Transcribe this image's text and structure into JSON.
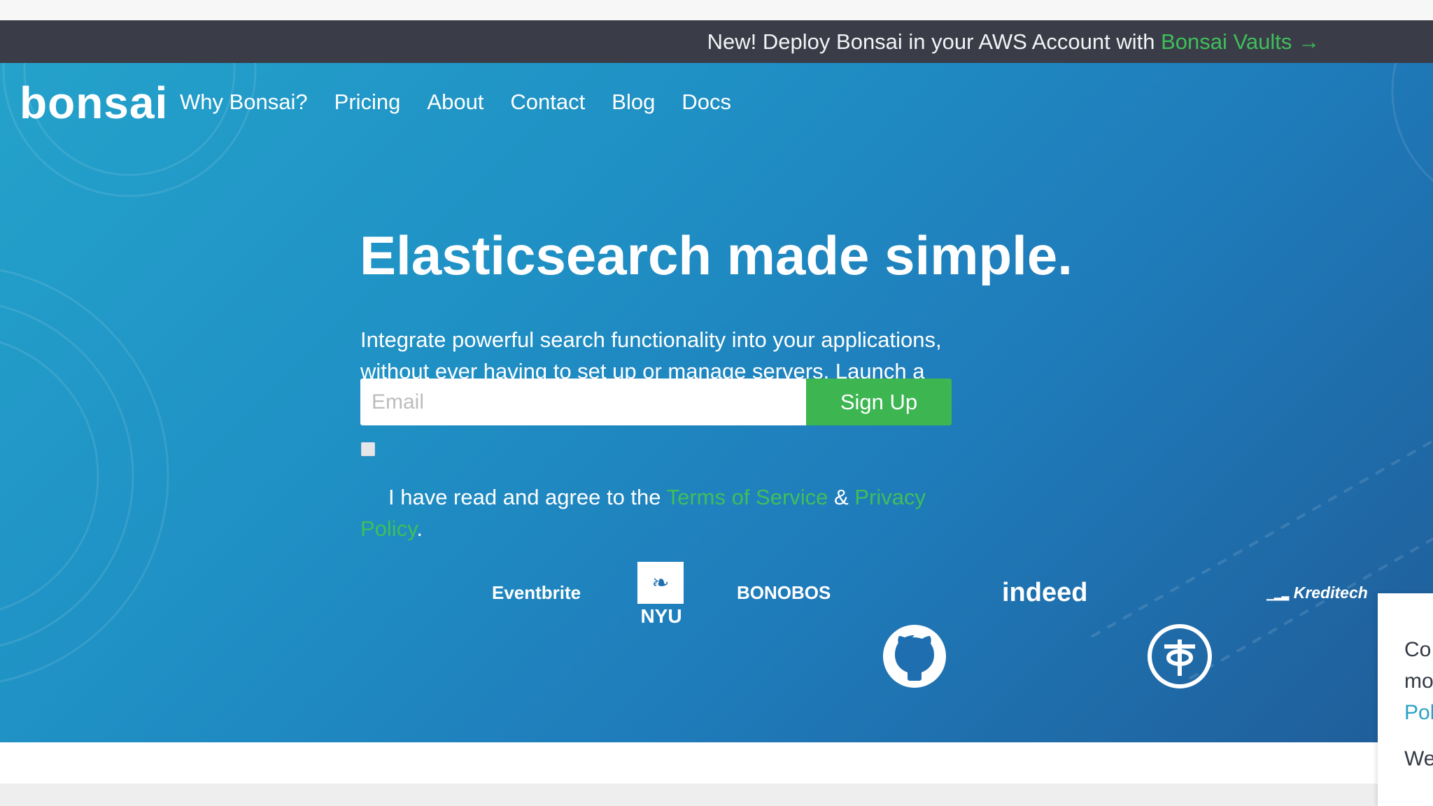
{
  "announcement": {
    "text": "New! Deploy Bonsai in your AWS Account with",
    "link_label": "Bonsai Vaults →"
  },
  "header": {
    "logo": "bonsai",
    "nav": [
      "Why Bonsai?",
      "Pricing",
      "About",
      "Contact",
      "Blog",
      "Docs"
    ]
  },
  "hero": {
    "headline": "Elasticsearch made simple.",
    "subheadline": "Integrate powerful search functionality into your applications, without ever having to set up or manage servers. Launch a development cluster for free."
  },
  "signup_form": {
    "email_placeholder": "Email",
    "submit_label": "Sign Up",
    "agree_prefix": "I have read and agree to the",
    "terms_label": "Terms of Service",
    "amp": "&",
    "privacy_label": "Privacy Policy",
    "period": ".",
    "agreed": false
  },
  "customers": {
    "eventbrite": "Eventbrite",
    "nyu": "NYU",
    "bonobos": "BONOBOS",
    "github_icon": "github-octocat-icon",
    "indeed": "indeed",
    "tc_icon": "tc-circle-logo-icon",
    "kreditech": "Kreditech"
  },
  "cookie_panel": {
    "line1": "Co",
    "line2": "mo",
    "line3": "Pol",
    "line4": "We"
  },
  "colors": {
    "announcement_bg": "#3a3d48",
    "accent_green": "#3db651",
    "hero_gradient_start": "#24a2cb",
    "hero_gradient_end": "#1f5d99",
    "cookie_link": "#2aa2c8"
  }
}
